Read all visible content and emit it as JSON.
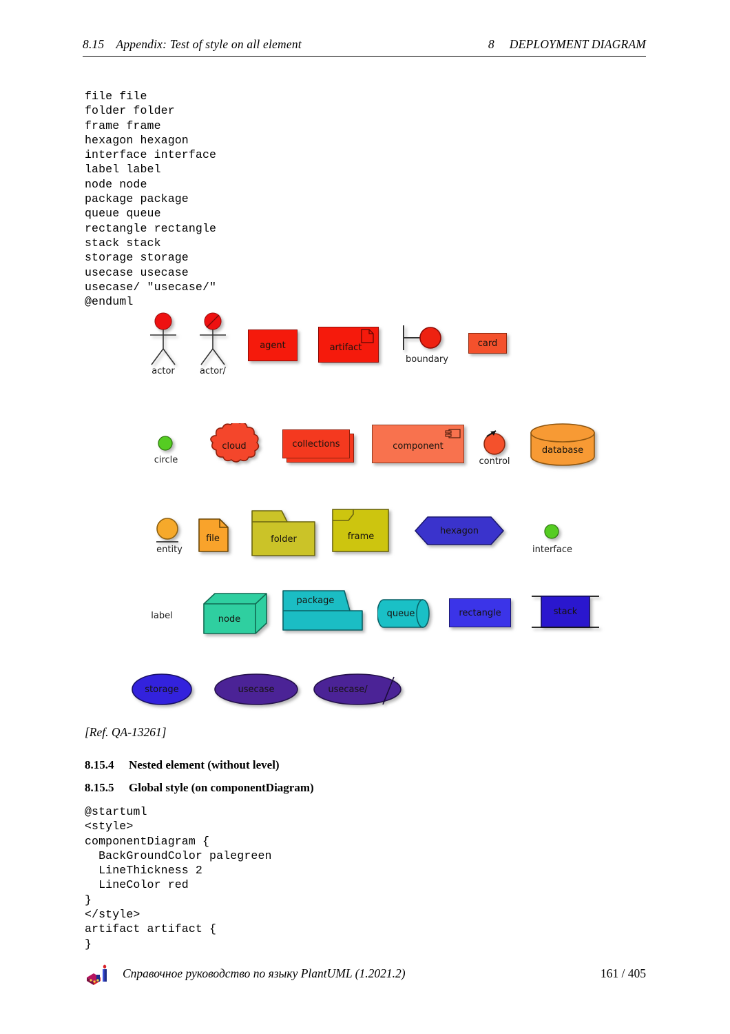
{
  "header": {
    "section_number": "8.15",
    "section_title": "Appendix: Test of style on all element",
    "chapter_number": "8",
    "chapter_title": "DEPLOYMENT DIAGRAM"
  },
  "code_top": "file file\nfolder folder\nframe frame\nhexagon hexagon\ninterface interface\nlabel label\nnode node\npackage package\nqueue queue\nrectangle rectangle\nstack stack\nstorage storage\nusecase usecase\nusecase/ \"usecase/\"\n@enduml",
  "code_bottom": "@startuml\n<style>\ncomponentDiagram {\n  BackGroundColor palegreen\n  LineThickness 2\n  LineColor red\n}\n</style>\nartifact artifact {\n}",
  "diagram": {
    "rows": [
      {
        "name": "row-1",
        "items": [
          {
            "key": "actor",
            "label": "actor",
            "caption": "actor",
            "shape": "actor",
            "fill": "#EE1111"
          },
          {
            "key": "actor-slash",
            "label": "actor/",
            "caption": "actor/",
            "shape": "actor-slash",
            "fill": "#EE1111"
          },
          {
            "key": "agent",
            "label": "agent",
            "caption": "",
            "shape": "rect",
            "fill": "#F51A0C"
          },
          {
            "key": "artifact",
            "label": "artifact",
            "caption": "",
            "shape": "artifact",
            "fill": "#F51A0C"
          },
          {
            "key": "boundary",
            "label": "",
            "caption": "boundary",
            "shape": "boundary",
            "fill": "#EE2211"
          },
          {
            "key": "card",
            "label": "card",
            "caption": "",
            "shape": "rect",
            "fill": "#F4512C"
          }
        ]
      },
      {
        "name": "row-2",
        "items": [
          {
            "key": "circle",
            "label": "",
            "caption": "circle",
            "shape": "circle-small",
            "fill": "#55CC22"
          },
          {
            "key": "cloud",
            "label": "cloud",
            "caption": "",
            "shape": "cloud",
            "fill": "#F4462B"
          },
          {
            "key": "collections",
            "label": "collections",
            "caption": "",
            "shape": "collections",
            "fill": "#F4391F"
          },
          {
            "key": "component",
            "label": "component",
            "caption": "",
            "shape": "component",
            "fill": "#F8724E"
          },
          {
            "key": "control",
            "label": "",
            "caption": "control",
            "shape": "control",
            "fill": "#F4512C"
          },
          {
            "key": "database",
            "label": "database",
            "caption": "",
            "shape": "database",
            "fill": "#F79A34"
          }
        ]
      },
      {
        "name": "row-3",
        "items": [
          {
            "key": "entity",
            "label": "",
            "caption": "entity",
            "shape": "entity",
            "fill": "#F6A92B"
          },
          {
            "key": "file",
            "label": "file",
            "caption": "",
            "shape": "file",
            "fill": "#F9A32B"
          },
          {
            "key": "folder",
            "label": "folder",
            "caption": "",
            "shape": "folder",
            "fill": "#CBC328"
          },
          {
            "key": "frame",
            "label": "frame",
            "caption": "",
            "shape": "frame",
            "fill": "#CDC50F"
          },
          {
            "key": "hexagon",
            "label": "hexagon",
            "caption": "",
            "shape": "hexagon",
            "fill": "#3A33CC"
          },
          {
            "key": "interface",
            "label": "",
            "caption": "interface",
            "shape": "circle-small",
            "fill": "#55CC22"
          }
        ]
      },
      {
        "name": "row-4",
        "items": [
          {
            "key": "label",
            "label": "",
            "caption": "label",
            "shape": "text-only",
            "fill": ""
          },
          {
            "key": "node",
            "label": "node",
            "caption": "",
            "shape": "node3d",
            "fill": "#2FCFA0"
          },
          {
            "key": "package",
            "label": "package",
            "caption": "",
            "shape": "package",
            "fill": "#1BBDC4"
          },
          {
            "key": "queue",
            "label": "queue",
            "caption": "",
            "shape": "queue",
            "fill": "#1AC0C6"
          },
          {
            "key": "rectangle",
            "label": "rectangle",
            "caption": "",
            "shape": "rect",
            "fill": "#3B34E8"
          },
          {
            "key": "stack",
            "label": "stack",
            "caption": "",
            "shape": "stack",
            "fill": "#2A17CE"
          }
        ]
      },
      {
        "name": "row-5",
        "items": [
          {
            "key": "storage",
            "label": "storage",
            "caption": "",
            "shape": "ellipse",
            "fill": "#3322DD"
          },
          {
            "key": "usecase",
            "label": "usecase",
            "caption": "",
            "shape": "ellipse",
            "fill": "#4B2396"
          },
          {
            "key": "usecase-slash",
            "label": "usecase/",
            "caption": "",
            "shape": "ellipse-slash",
            "fill": "#4B2396"
          }
        ]
      }
    ]
  },
  "ref_note": "[Ref. QA-13261]",
  "sections": [
    {
      "number": "8.15.4",
      "title": "Nested element (without level)"
    },
    {
      "number": "8.15.5",
      "title": "Global style (on componentDiagram)"
    }
  ],
  "footer": {
    "text": "Справочное руководство по языку PlantUML (1.2021.2)",
    "page": "161 / 405"
  }
}
